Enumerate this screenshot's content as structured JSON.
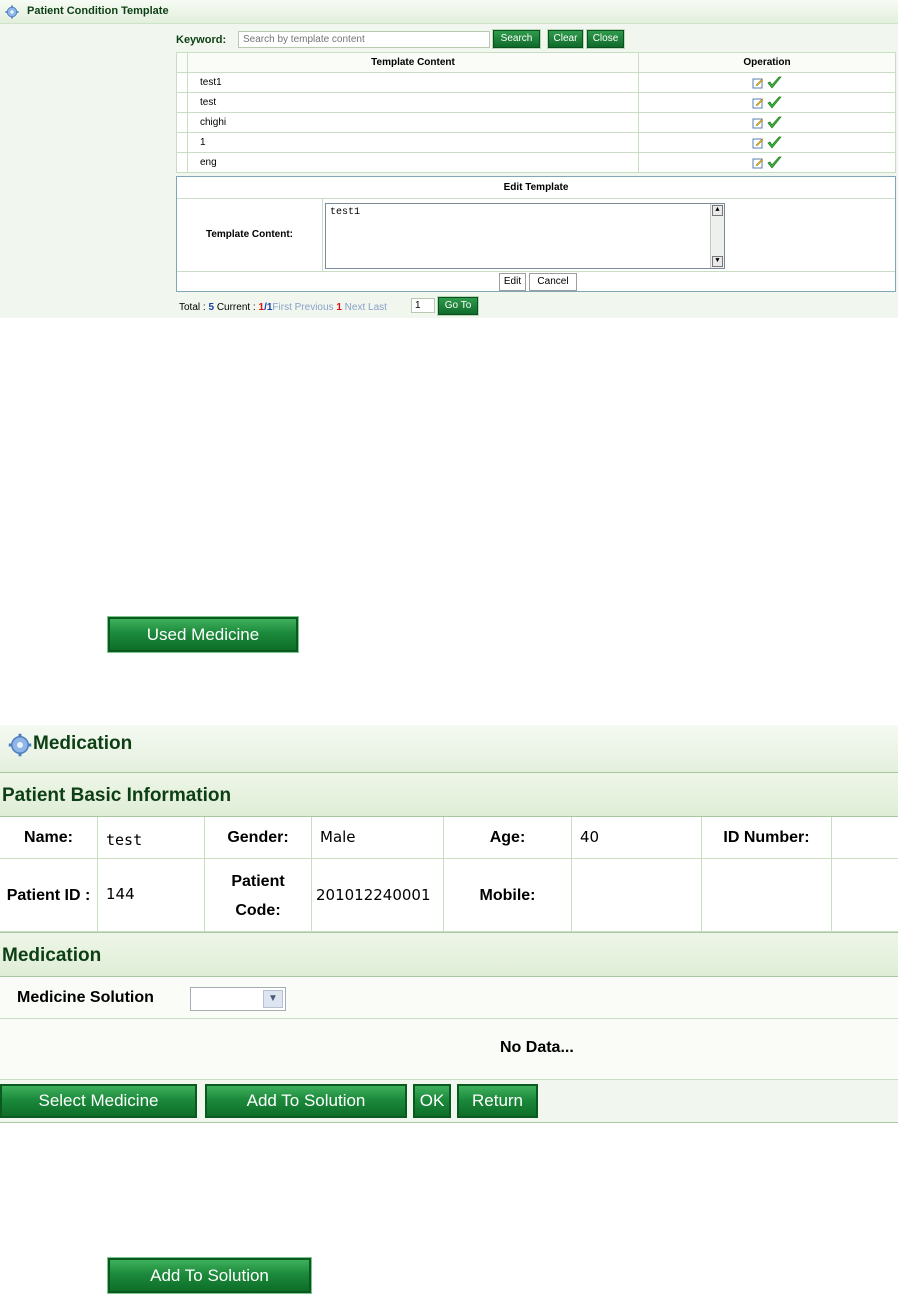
{
  "template_panel": {
    "title": "Patient Condition Template",
    "keyword_label": "Keyword:",
    "keyword_placeholder": "Search by template content",
    "search_label": "Search",
    "clear_label": "Clear",
    "close_label": "Close",
    "columns": [
      "Template Content",
      "Operation"
    ],
    "rows": [
      "test1",
      "test",
      "chighi",
      "1",
      "eng"
    ],
    "edit": {
      "header": "Edit Template",
      "content_label": "Template Content:",
      "content_value": "test1",
      "edit_label": "Edit",
      "cancel_label": "Cancel"
    },
    "pager": {
      "total_label": "Total :",
      "total": "5",
      "current_label": "Current :",
      "current": "1",
      "sep": "/",
      "pages": "1",
      "first": "First",
      "previous": "Previous",
      "page": "1",
      "next": "Next",
      "last": "Last",
      "goto_value": "1",
      "goto_label": "Go To"
    }
  },
  "used_medicine_button": "Used Medicine",
  "medication_panel": {
    "title": "Medication",
    "basic_section": "Patient Basic Information",
    "fields": {
      "name_label": "Name:",
      "name": "test",
      "gender_label": "Gender:",
      "gender": "Male",
      "age_label": "Age:",
      "age": "40",
      "id_number_label": "ID Number:",
      "patient_id_label": "Patient ID :",
      "patient_id": "144",
      "patient_code_label_1": "Patient",
      "patient_code_label_2": "Code:",
      "patient_code": "201012240001",
      "mobile_label": "Mobile:"
    },
    "medication_section": "Medication",
    "medicine_solution_label": "Medicine Solution",
    "no_data": "No Data...",
    "buttons": {
      "select_medicine": "Select Medicine",
      "add_to_solution": "Add To Solution",
      "ok": "OK",
      "return": "Return"
    }
  },
  "add_to_solution_button": "Add To Solution",
  "colors": {
    "brand_green": "#0d6e28",
    "header_text": "#0d3f14",
    "panel_bg": "#f1f7ef"
  }
}
